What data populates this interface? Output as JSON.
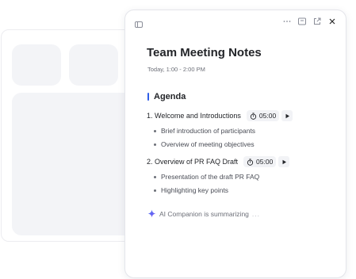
{
  "window": {
    "title": "Team Meeting Notes",
    "time": "Today, 1:00 - 2:00 PM"
  },
  "toolbar": {
    "icons": [
      "sidebar-toggle-icon",
      "more-icon",
      "save-icon",
      "open-external-icon",
      "close-icon"
    ]
  },
  "agenda": {
    "heading": "Agenda",
    "items": [
      {
        "label": "1. Welcome and Introductions",
        "timer": "05:00",
        "bullets": [
          "Brief introduction of participants",
          "Overview of meeting objectives"
        ]
      },
      {
        "label": "2. Overview of PR FAQ Draft",
        "timer": "05:00",
        "bullets": [
          "Presentation of the draft PR FAQ",
          "Highlighting key points"
        ]
      }
    ]
  },
  "ai_status": {
    "text": "AI Companion is summarizing",
    "ellipsis": "..."
  },
  "colors": {
    "accent": "#2f5ee8",
    "sparkle_blue": "#3b6ef0",
    "sparkle_purple": "#8b5cf6"
  }
}
